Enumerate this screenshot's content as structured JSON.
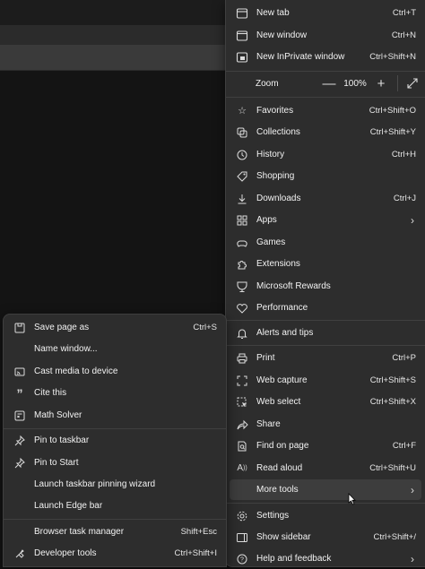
{
  "main_menu": {
    "items_top": [
      {
        "label": "New tab",
        "shortcut": "Ctrl+T",
        "icon": "new-tab-icon"
      },
      {
        "label": "New window",
        "shortcut": "Ctrl+N",
        "icon": "new-window-icon"
      },
      {
        "label": "New InPrivate window",
        "shortcut": "Ctrl+Shift+N",
        "icon": "inprivate-icon"
      }
    ],
    "zoom": {
      "label": "Zoom",
      "value": "100%",
      "minus": "—",
      "plus": "+"
    },
    "items_mid": [
      {
        "label": "Favorites",
        "shortcut": "Ctrl+Shift+O",
        "icon": "favorites-icon"
      },
      {
        "label": "Collections",
        "shortcut": "Ctrl+Shift+Y",
        "icon": "collections-icon"
      },
      {
        "label": "History",
        "shortcut": "Ctrl+H",
        "icon": "history-icon"
      },
      {
        "label": "Shopping",
        "shortcut": "",
        "icon": "shopping-tag-icon"
      },
      {
        "label": "Downloads",
        "shortcut": "Ctrl+J",
        "icon": "download-icon"
      },
      {
        "label": "Apps",
        "shortcut": "",
        "icon": "apps-icon"
      },
      {
        "label": "Games",
        "shortcut": "",
        "icon": "games-icon"
      },
      {
        "label": "Extensions",
        "shortcut": "",
        "icon": "extensions-icon"
      },
      {
        "label": "Microsoft Rewards",
        "shortcut": "",
        "icon": "rewards-icon"
      },
      {
        "label": "Performance",
        "shortcut": "",
        "icon": "performance-icon"
      }
    ],
    "alerts": {
      "label": "Alerts and tips",
      "icon": "bell-icon"
    },
    "items_low": [
      {
        "label": "Print",
        "shortcut": "Ctrl+P",
        "icon": "print-icon"
      },
      {
        "label": "Web capture",
        "shortcut": "Ctrl+Shift+S",
        "icon": "web-capture-icon"
      },
      {
        "label": "Web select",
        "shortcut": "Ctrl+Shift+X",
        "icon": "web-select-icon"
      },
      {
        "label": "Share",
        "shortcut": "",
        "icon": "share-icon"
      },
      {
        "label": "Find on page",
        "shortcut": "Ctrl+F",
        "icon": "find-icon"
      },
      {
        "label": "Read aloud",
        "shortcut": "Ctrl+Shift+U",
        "icon": "read-aloud-icon"
      },
      {
        "label": "More tools",
        "shortcut": "",
        "icon": ""
      }
    ],
    "items_bottom": [
      {
        "label": "Settings",
        "shortcut": "",
        "icon": "settings-icon"
      },
      {
        "label": "Show sidebar",
        "shortcut": "Ctrl+Shift+/",
        "icon": "sidebar-icon"
      },
      {
        "label": "Help and feedback",
        "shortcut": "",
        "icon": "help-icon"
      }
    ]
  },
  "sub_menu": {
    "group1": [
      {
        "label": "Save page as",
        "shortcut": "Ctrl+S",
        "icon": "save-icon"
      },
      {
        "label": "Name window...",
        "shortcut": "",
        "icon": ""
      },
      {
        "label": "Cast media to device",
        "shortcut": "",
        "icon": "cast-icon"
      },
      {
        "label": "Cite this",
        "shortcut": "",
        "icon": "quote-icon"
      },
      {
        "label": "Math Solver",
        "shortcut": "",
        "icon": "math-solver-icon"
      }
    ],
    "group2": [
      {
        "label": "Pin to taskbar",
        "shortcut": "",
        "icon": "pin-icon"
      },
      {
        "label": "Pin to Start",
        "shortcut": "",
        "icon": "pin-icon"
      },
      {
        "label": "Launch taskbar pinning wizard",
        "shortcut": "",
        "icon": ""
      },
      {
        "label": "Launch Edge bar",
        "shortcut": "",
        "icon": ""
      }
    ],
    "group3": [
      {
        "label": "Browser task manager",
        "shortcut": "Shift+Esc",
        "icon": ""
      },
      {
        "label": "Developer tools",
        "shortcut": "Ctrl+Shift+I",
        "icon": "developer-tools-icon"
      }
    ]
  }
}
